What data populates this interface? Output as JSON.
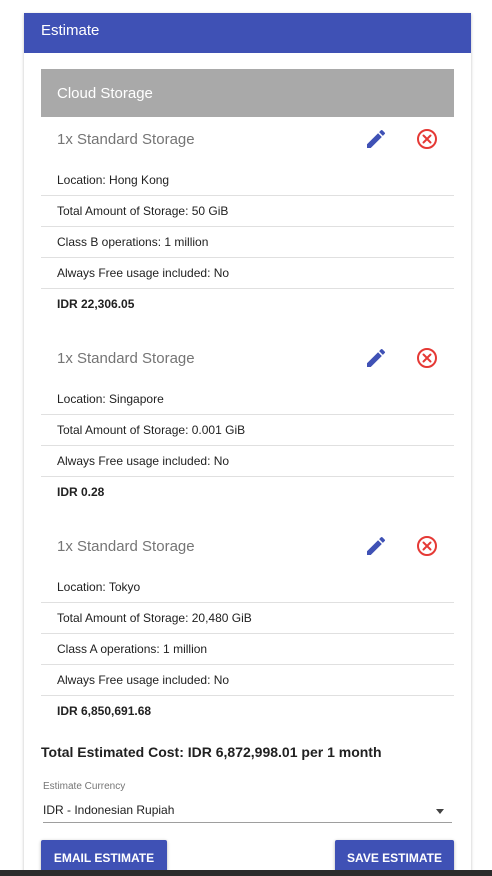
{
  "header": {
    "title": "Estimate"
  },
  "section": {
    "title": "Cloud Storage"
  },
  "items": [
    {
      "title": "1x Standard Storage",
      "details": [
        "Location: Hong Kong",
        "Total Amount of Storage: 50 GiB",
        "Class B operations: 1 million",
        "Always Free usage included: No"
      ],
      "cost": "IDR 22,306.05"
    },
    {
      "title": "1x Standard Storage",
      "details": [
        "Location: Singapore",
        "Total Amount of Storage: 0.001 GiB",
        "Always Free usage included: No"
      ],
      "cost": "IDR 0.28"
    },
    {
      "title": "1x Standard Storage",
      "details": [
        "Location: Tokyo",
        "Total Amount of Storage: 20,480 GiB",
        "Class A operations: 1 million",
        "Always Free usage included: No"
      ],
      "cost": "IDR 6,850,691.68"
    }
  ],
  "icons": {
    "edit": "pencil-icon",
    "remove": "close-circle-icon"
  },
  "colors": {
    "primary": "#3f51b5",
    "section_header": "#a9a9a9",
    "remove": "#e53935"
  },
  "total": {
    "text": "Total Estimated Cost: IDR 6,872,998.01 per 1 month"
  },
  "currency": {
    "label": "Estimate Currency",
    "value": "IDR - Indonesian Rupiah"
  },
  "actions": {
    "email_label": "EMAIL ESTIMATE",
    "save_label": "SAVE ESTIMATE"
  }
}
